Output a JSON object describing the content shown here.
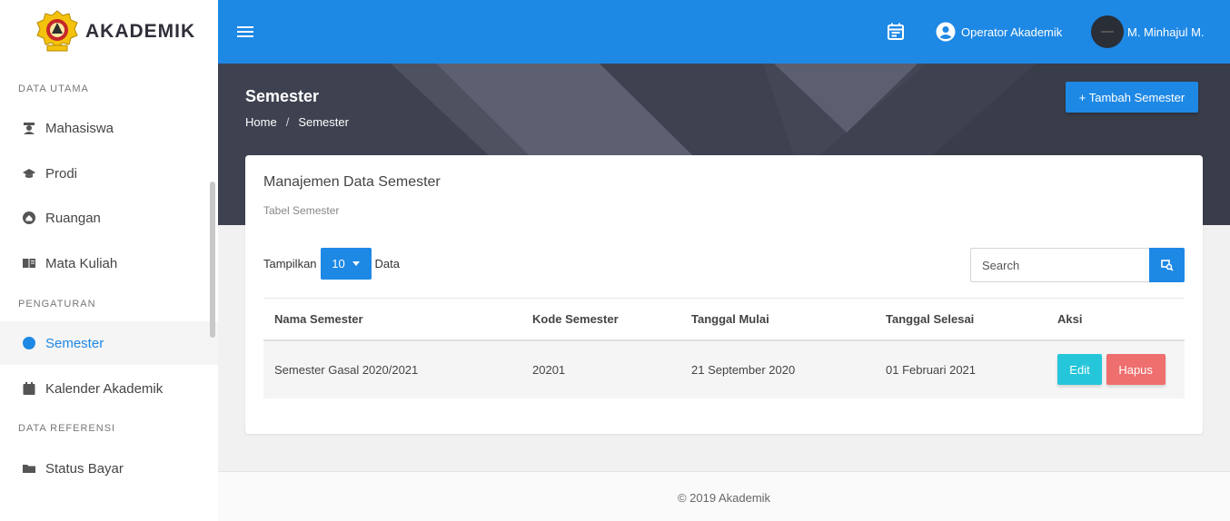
{
  "brand": {
    "name": "AKADEMIK",
    "logo_icon": "university-seal-icon"
  },
  "sidebar": {
    "sections": [
      {
        "label": "DATA UTAMA"
      },
      {
        "label": "PENGATURAN"
      },
      {
        "label": "DATA REFERENSI"
      }
    ],
    "items": [
      {
        "label": "Mahasiswa",
        "icon": "graduate-icon"
      },
      {
        "label": "Prodi",
        "icon": "mortarboard-icon"
      },
      {
        "label": "Ruangan",
        "icon": "home-icon"
      },
      {
        "label": "Mata Kuliah",
        "icon": "book-icon"
      },
      {
        "label": "Semester",
        "icon": "clock-icon",
        "active": true
      },
      {
        "label": "Kalender Akademik",
        "icon": "calendar-icon"
      },
      {
        "label": "Status Bayar",
        "icon": "folder-icon"
      }
    ]
  },
  "topbar": {
    "menu_icon": "hamburger-icon",
    "calendar_icon": "event-calendar-icon",
    "role_label": "Operator Akademik",
    "user_name": "M. Minhajul M.",
    "accent": "#1e88e5"
  },
  "header": {
    "title": "Semester",
    "breadcrumb": [
      "Home",
      "Semester"
    ],
    "breadcrumb_sep": "/",
    "add_button": "+ Tambah Semester"
  },
  "card": {
    "title": "Manajemen Data Semester",
    "subtitle": "Tabel Semester",
    "show_prefix": "Tampilkan",
    "page_size": "10",
    "show_suffix": "Data",
    "search_placeholder": "Search"
  },
  "table": {
    "columns": [
      "Nama Semester",
      "Kode Semester",
      "Tanggal Mulai",
      "Tanggal Selesai",
      "Aksi"
    ],
    "rows": [
      {
        "nama": "Semester Gasal 2020/2021",
        "kode": "20201",
        "mulai": "21 September 2020",
        "selesai": "01 Februari 2021",
        "edit_label": "Edit",
        "delete_label": "Hapus"
      }
    ]
  },
  "footer": {
    "text": "© 2019 Akademik"
  }
}
